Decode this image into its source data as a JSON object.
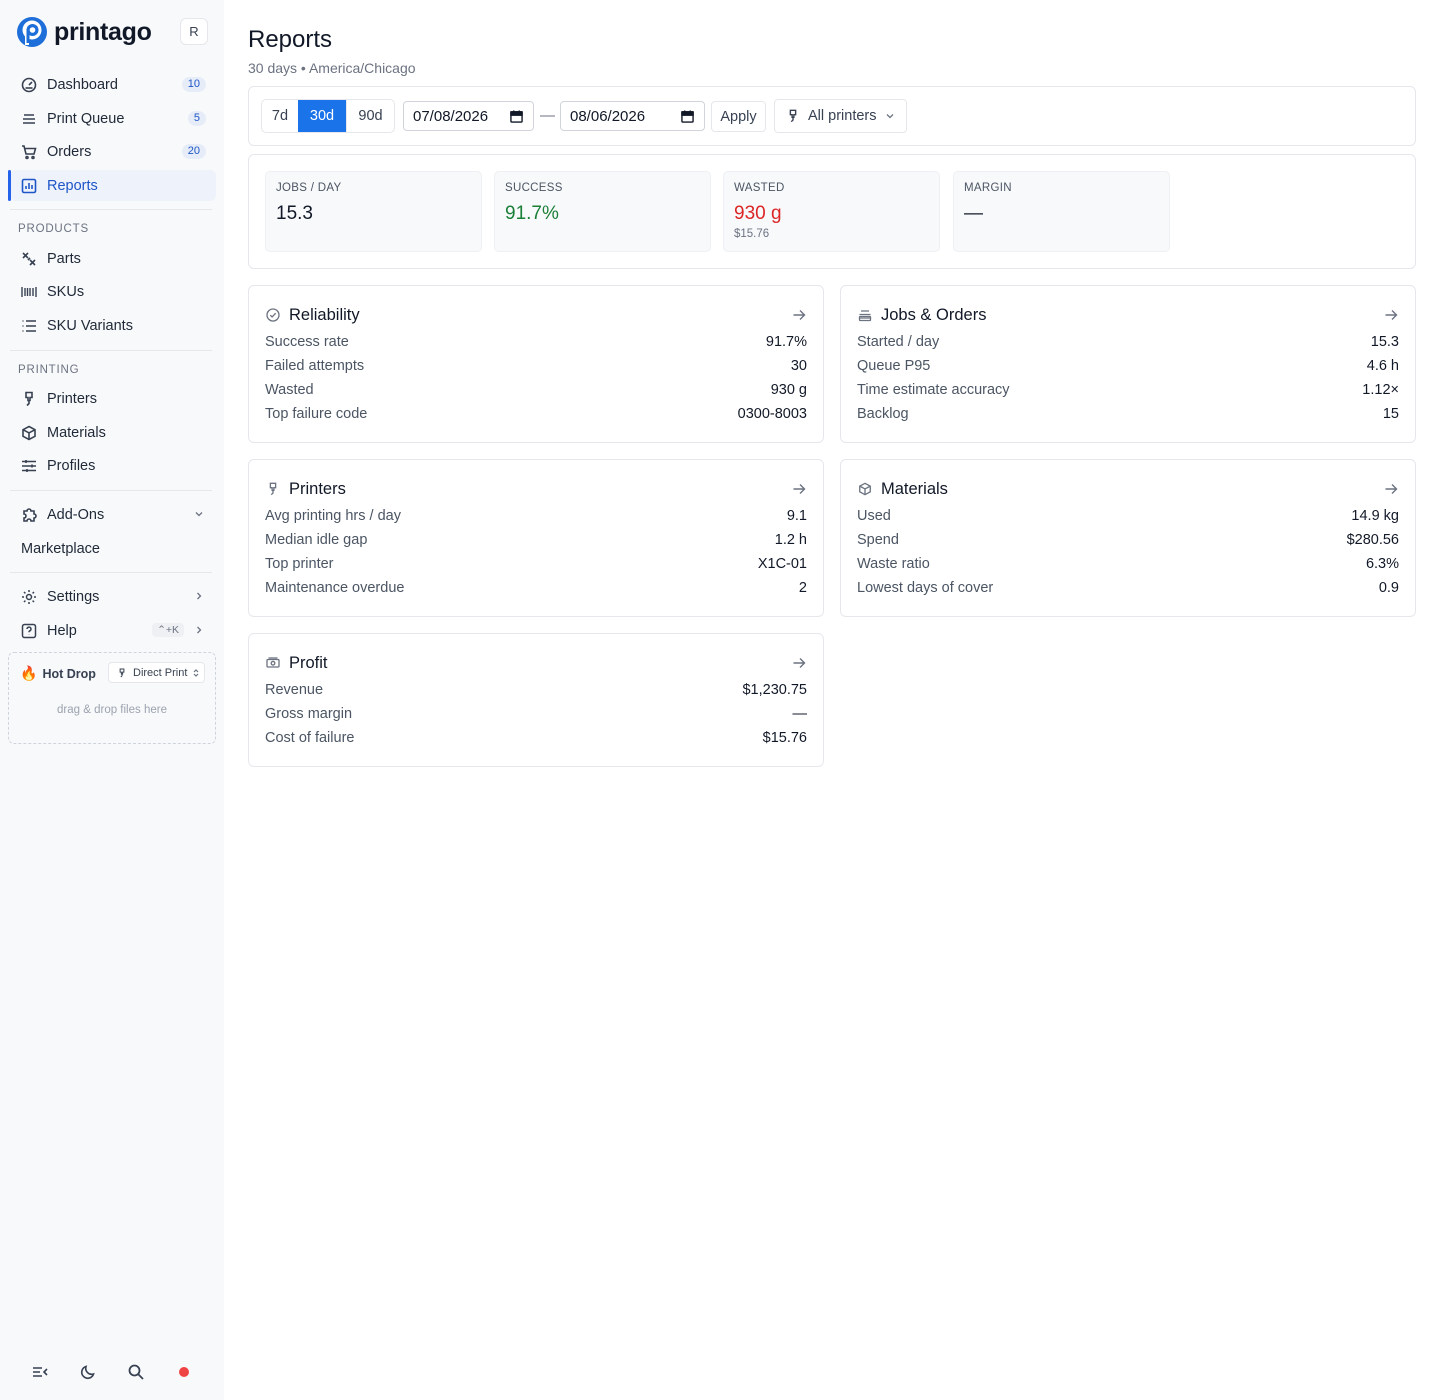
{
  "app": {
    "name": "printago",
    "user_initial": "R"
  },
  "sidebar": {
    "main_items": [
      {
        "label": "Dashboard",
        "badge": "10",
        "icon": "dashboard-gauge-icon"
      },
      {
        "label": "Print Queue",
        "badge": "5",
        "icon": "stack-icon"
      },
      {
        "label": "Orders",
        "badge": "20",
        "icon": "cart-icon"
      },
      {
        "label": "Reports",
        "badge": "",
        "icon": "bar-chart-icon",
        "active": true
      }
    ],
    "products_label": "PRODUCTS",
    "product_items": [
      {
        "label": "Parts",
        "icon": "parts-icon"
      },
      {
        "label": "SKUs",
        "icon": "barcode-icon"
      },
      {
        "label": "SKU Variants",
        "icon": "list-icon"
      }
    ],
    "printing_label": "PRINTING",
    "printing_items": [
      {
        "label": "Printers",
        "icon": "printer-nozzle-icon"
      },
      {
        "label": "Materials",
        "icon": "cube-icon"
      },
      {
        "label": "Profiles",
        "icon": "sliders-icon"
      }
    ],
    "addons_label": "Add-Ons",
    "marketplace_label": "Marketplace",
    "settings_label": "Settings",
    "help_label": "Help",
    "help_shortcut": "⌃+K",
    "hotdrop": {
      "title": "Hot Drop",
      "mode": "Direct Print",
      "hint": "drag & drop files here"
    }
  },
  "header": {
    "title": "Reports",
    "subtitle": "30 days • America/Chicago"
  },
  "filters": {
    "ranges": [
      "7d",
      "30d",
      "90d"
    ],
    "selected_range": "30d",
    "start_date": "07/08/2026",
    "end_date": "08/06/2026",
    "separator": "—",
    "apply_label": "Apply",
    "printer_filter": "All printers"
  },
  "kpis": [
    {
      "label": "JOBS / DAY",
      "value": "15.3",
      "sub": "",
      "color": "#111827"
    },
    {
      "label": "SUCCESS",
      "value": "91.7%",
      "sub": "",
      "color": "#1a7f37"
    },
    {
      "label": "WASTED",
      "value": "930 g",
      "sub": "$15.76",
      "color": "#dc2626"
    },
    {
      "label": "MARGIN",
      "value": "—",
      "sub": "",
      "color": "#111827"
    }
  ],
  "cards": {
    "reliability": {
      "title": "Reliability",
      "rows": [
        {
          "label": "Success rate",
          "value": "91.7%"
        },
        {
          "label": "Failed attempts",
          "value": "30"
        },
        {
          "label": "Wasted",
          "value": "930 g"
        },
        {
          "label": "Top failure code",
          "value": "0300-8003"
        }
      ]
    },
    "jobs_orders": {
      "title": "Jobs & Orders",
      "rows": [
        {
          "label": "Started / day",
          "value": "15.3"
        },
        {
          "label": "Queue P95",
          "value": "4.6 h"
        },
        {
          "label": "Time estimate accuracy",
          "value": "1.12×"
        },
        {
          "label": "Backlog",
          "value": "15"
        }
      ]
    },
    "printers": {
      "title": "Printers",
      "rows": [
        {
          "label": "Avg printing hrs / day",
          "value": "9.1"
        },
        {
          "label": "Median idle gap",
          "value": "1.2 h"
        },
        {
          "label": "Top printer",
          "value": "X1C-01"
        },
        {
          "label": "Maintenance overdue",
          "value": "2"
        }
      ]
    },
    "materials": {
      "title": "Materials",
      "rows": [
        {
          "label": "Used",
          "value": "14.9 kg"
        },
        {
          "label": "Spend",
          "value": "$280.56"
        },
        {
          "label": "Waste ratio",
          "value": "6.3%"
        },
        {
          "label": "Lowest days of cover",
          "value": "0.9"
        }
      ]
    },
    "profit": {
      "title": "Profit",
      "rows": [
        {
          "label": "Revenue",
          "value": "$1,230.75"
        },
        {
          "label": "Gross margin",
          "value": "—"
        },
        {
          "label": "Cost of failure",
          "value": "$15.76"
        }
      ]
    }
  }
}
